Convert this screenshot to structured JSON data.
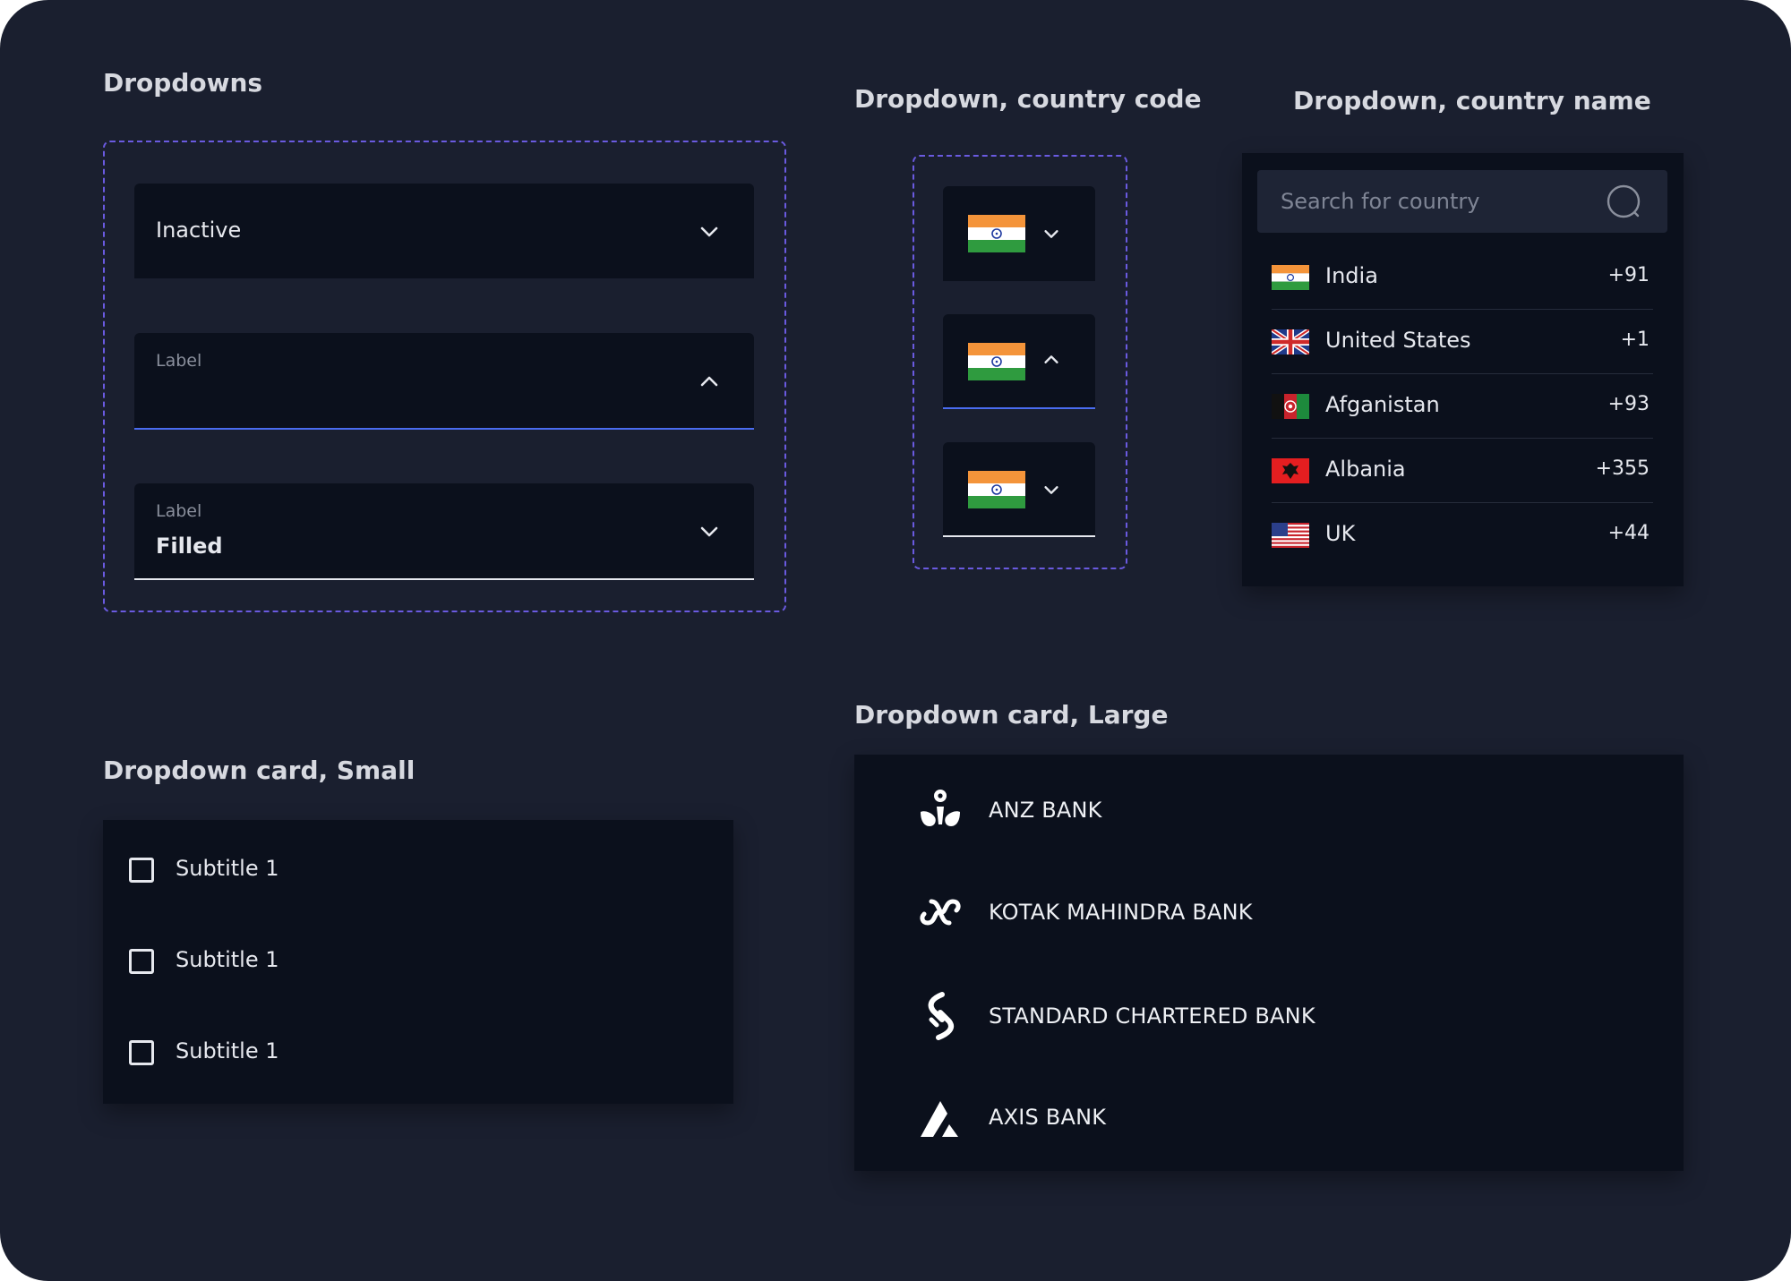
{
  "colors": {
    "background": "#1a1f2f",
    "surface": "#0b101c",
    "dashed_border": "#6a5ae0",
    "active_underline": "#4a6cf0",
    "filled_underline": "#e6e8ee"
  },
  "dropdowns": {
    "heading": "Dropdowns",
    "inactive": {
      "value": "Inactive",
      "icon": "chevron-down-icon"
    },
    "active": {
      "label": "Label",
      "icon": "chevron-up-icon"
    },
    "filled": {
      "label": "Label",
      "value": "Filled",
      "icon": "chevron-down-icon"
    }
  },
  "country_code": {
    "heading": "Dropdown, country code",
    "states": [
      {
        "flag": "india-flag",
        "icon": "chevron-down-icon",
        "state": "inactive"
      },
      {
        "flag": "india-flag",
        "icon": "chevron-up-icon",
        "state": "active"
      },
      {
        "flag": "india-flag",
        "icon": "chevron-down-icon",
        "state": "filled"
      }
    ]
  },
  "country_name": {
    "heading": "Dropdown, country name",
    "search_placeholder": "Search for country",
    "search_icon": "search-icon",
    "countries": [
      {
        "name": "India",
        "code": "+91",
        "flag": "india-flag"
      },
      {
        "name": "United States",
        "code": "+1",
        "flag": "uk-flag"
      },
      {
        "name": "Afganistan",
        "code": "+93",
        "flag": "afghanistan-flag"
      },
      {
        "name": "Albania",
        "code": "+355",
        "flag": "albania-flag"
      },
      {
        "name": "UK",
        "code": "+44",
        "flag": "us-flag"
      }
    ]
  },
  "card_small": {
    "heading": "Dropdown card, Small",
    "items": [
      {
        "label": "Subtitle 1",
        "checked": false
      },
      {
        "label": "Subtitle 1",
        "checked": false
      },
      {
        "label": "Subtitle 1",
        "checked": false
      }
    ]
  },
  "card_large": {
    "heading": "Dropdown card, Large",
    "banks": [
      {
        "name": "ANZ BANK",
        "icon": "anz-logo-icon"
      },
      {
        "name": "KOTAK MAHINDRA  BANK",
        "icon": "kotak-logo-icon"
      },
      {
        "name": "STANDARD CHARTERED BANK",
        "icon": "standard-chartered-logo-icon"
      },
      {
        "name": "AXIS BANK",
        "icon": "axis-logo-icon"
      }
    ]
  }
}
